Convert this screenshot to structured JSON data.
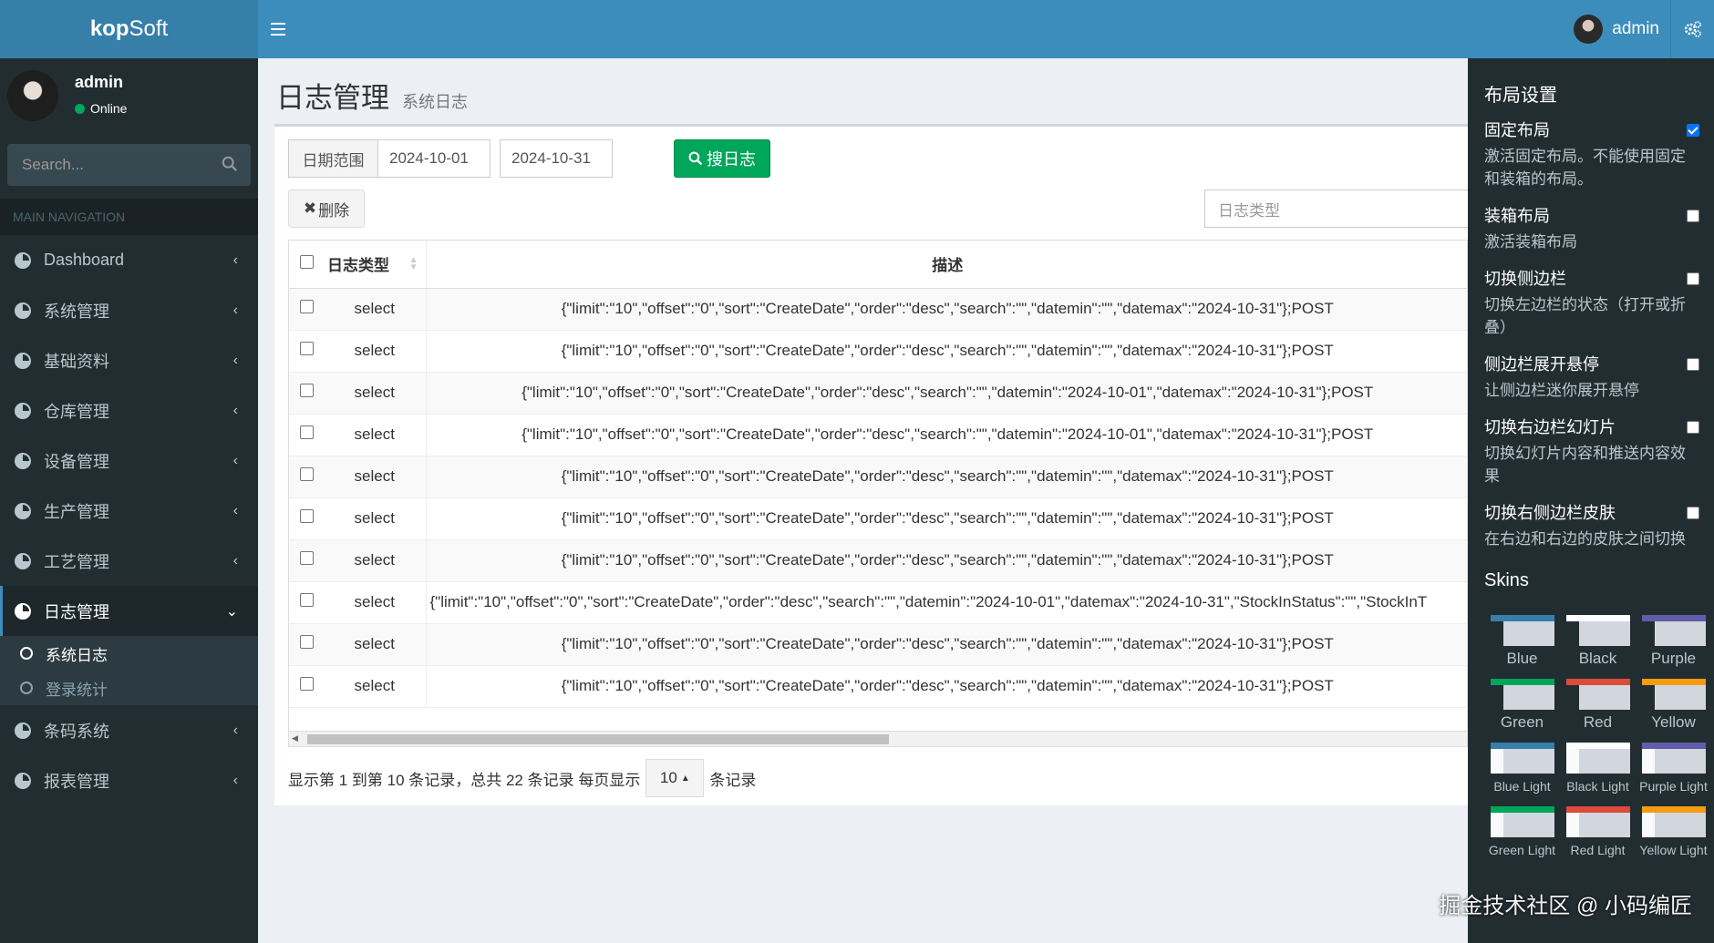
{
  "app": {
    "logo_bold": "kop",
    "logo_rest": "Soft"
  },
  "topbar": {
    "user_name": "admin"
  },
  "sidebar": {
    "user_name": "admin",
    "status": "Online",
    "search_placeholder": "Search...",
    "nav_header": "MAIN NAVIGATION",
    "items": [
      {
        "label": "Dashboard"
      },
      {
        "label": "系统管理"
      },
      {
        "label": "基础资料"
      },
      {
        "label": "仓库管理"
      },
      {
        "label": "设备管理"
      },
      {
        "label": "生产管理"
      },
      {
        "label": "工艺管理"
      },
      {
        "label": "日志管理"
      },
      {
        "label": "条码系统"
      },
      {
        "label": "报表管理"
      }
    ],
    "submenu": [
      {
        "label": "系统日志"
      },
      {
        "label": "登录统计"
      }
    ]
  },
  "page": {
    "title": "日志管理",
    "subtitle": "系统日志"
  },
  "filters": {
    "date_range_label": "日期范围",
    "date_from": "2024-10-01",
    "date_to": "2024-10-31",
    "search_button": "搜日志",
    "delete_button": "删除",
    "log_type_placeholder": "日志类型"
  },
  "table": {
    "columns": [
      "日志类型",
      "描述"
    ],
    "rows": [
      {
        "type": "select",
        "desc": "{\"limit\":\"10\",\"offset\":\"0\",\"sort\":\"CreateDate\",\"order\":\"desc\",\"search\":\"\",\"datemin\":\"\",\"datemax\":\"2024-10-31\"};POST"
      },
      {
        "type": "select",
        "desc": "{\"limit\":\"10\",\"offset\":\"0\",\"sort\":\"CreateDate\",\"order\":\"desc\",\"search\":\"\",\"datemin\":\"\",\"datemax\":\"2024-10-31\"};POST"
      },
      {
        "type": "select",
        "desc": "{\"limit\":\"10\",\"offset\":\"0\",\"sort\":\"CreateDate\",\"order\":\"desc\",\"search\":\"\",\"datemin\":\"2024-10-01\",\"datemax\":\"2024-10-31\"};POST"
      },
      {
        "type": "select",
        "desc": "{\"limit\":\"10\",\"offset\":\"0\",\"sort\":\"CreateDate\",\"order\":\"desc\",\"search\":\"\",\"datemin\":\"2024-10-01\",\"datemax\":\"2024-10-31\"};POST"
      },
      {
        "type": "select",
        "desc": "{\"limit\":\"10\",\"offset\":\"0\",\"sort\":\"CreateDate\",\"order\":\"desc\",\"search\":\"\",\"datemin\":\"\",\"datemax\":\"2024-10-31\"};POST"
      },
      {
        "type": "select",
        "desc": "{\"limit\":\"10\",\"offset\":\"0\",\"sort\":\"CreateDate\",\"order\":\"desc\",\"search\":\"\",\"datemin\":\"\",\"datemax\":\"2024-10-31\"};POST"
      },
      {
        "type": "select",
        "desc": "{\"limit\":\"10\",\"offset\":\"0\",\"sort\":\"CreateDate\",\"order\":\"desc\",\"search\":\"\",\"datemin\":\"\",\"datemax\":\"2024-10-31\"};POST"
      },
      {
        "type": "select",
        "desc": "{\"limit\":\"10\",\"offset\":\"0\",\"sort\":\"CreateDate\",\"order\":\"desc\",\"search\":\"\",\"datemin\":\"2024-10-01\",\"datemax\":\"2024-10-31\",\"StockInStatus\":\"\",\"StockInT"
      },
      {
        "type": "select",
        "desc": "{\"limit\":\"10\",\"offset\":\"0\",\"sort\":\"CreateDate\",\"order\":\"desc\",\"search\":\"\",\"datemin\":\"\",\"datemax\":\"2024-10-31\"};POST"
      },
      {
        "type": "select",
        "desc": "{\"limit\":\"10\",\"offset\":\"0\",\"sort\":\"CreateDate\",\"order\":\"desc\",\"search\":\"\",\"datemin\":\"\",\"datemax\":\"2024-10-31\"};POST"
      }
    ]
  },
  "pagination": {
    "summary": "显示第 1 到第 10 条记录，总共 22 条记录 每页显示",
    "page_size": "10",
    "suffix": "条记录"
  },
  "control_sidebar": {
    "layout_title": "布局设置",
    "options": [
      {
        "title": "固定布局",
        "desc": "激活固定布局。不能使用固定和装箱的布局。",
        "checked": true
      },
      {
        "title": "装箱布局",
        "desc": "激活装箱布局",
        "checked": false
      },
      {
        "title": "切换侧边栏",
        "desc": "切换左边栏的状态（打开或折叠）",
        "checked": false
      },
      {
        "title": "侧边栏展开悬停",
        "desc": "让侧边栏迷你展开悬停",
        "checked": false
      },
      {
        "title": "切换右边栏幻灯片",
        "desc": "切换幻灯片内容和推送内容效果",
        "checked": false
      },
      {
        "title": "切换右侧边栏皮肤",
        "desc": "在右边和右边的皮肤之间切换",
        "checked": false
      }
    ],
    "skins_title": "Skins",
    "skins": [
      {
        "label": "Blue",
        "color": "#367fa9"
      },
      {
        "label": "Black",
        "color": "#fefefe"
      },
      {
        "label": "Purple",
        "color": "#605ca8"
      },
      {
        "label": "Green",
        "color": "#00a65a"
      },
      {
        "label": "Red",
        "color": "#dd4b39"
      },
      {
        "label": "Yellow",
        "color": "#f39c12"
      },
      {
        "label": "Blue Light",
        "color": "#367fa9"
      },
      {
        "label": "Black Light",
        "color": "#fefefe"
      },
      {
        "label": "Purple Light",
        "color": "#605ca8"
      },
      {
        "label": "Green Light",
        "color": "#00a65a"
      },
      {
        "label": "Red Light",
        "color": "#dd4b39"
      },
      {
        "label": "Yellow Light",
        "color": "#f39c12"
      }
    ]
  },
  "watermark": "掘金技术社区 @ 小码编匠"
}
